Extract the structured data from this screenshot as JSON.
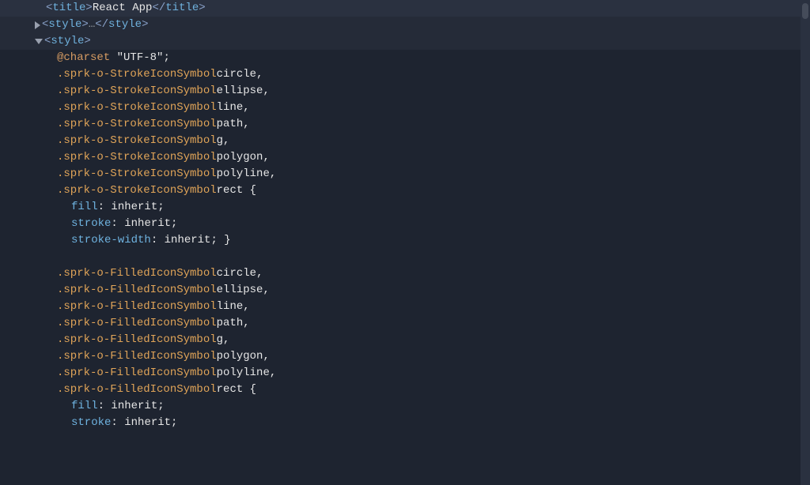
{
  "dom_tree": {
    "title_tag": {
      "open": "<title>",
      "text": "React App",
      "close": "</title>"
    },
    "collapsed_style": {
      "open": "<style>",
      "ellipsis": "…",
      "close": "</style>"
    },
    "expanded_style_open": "<style>"
  },
  "css": {
    "charset_rule": {
      "at": "@charset ",
      "value": "\"UTF-8\"",
      "semi": ";"
    },
    "stroke_selectors": [
      ".sprk-o-StrokeIconSymbol circle,",
      ".sprk-o-StrokeIconSymbol ellipse,",
      ".sprk-o-StrokeIconSymbol line,",
      ".sprk-o-StrokeIconSymbol path,",
      ".sprk-o-StrokeIconSymbol g,",
      ".sprk-o-StrokeIconSymbol polygon,",
      ".sprk-o-StrokeIconSymbol polyline,",
      ".sprk-o-StrokeIconSymbol rect {"
    ],
    "stroke_decls": [
      {
        "prop": "fill",
        "value": "inherit",
        "tail": ";"
      },
      {
        "prop": "stroke",
        "value": "inherit",
        "tail": ";"
      },
      {
        "prop": "stroke-width",
        "value": "inherit",
        "tail": "; }"
      }
    ],
    "filled_selectors": [
      ".sprk-o-FilledIconSymbol circle,",
      ".sprk-o-FilledIconSymbol ellipse,",
      ".sprk-o-FilledIconSymbol line,",
      ".sprk-o-FilledIconSymbol path,",
      ".sprk-o-FilledIconSymbol g,",
      ".sprk-o-FilledIconSymbol polygon,",
      ".sprk-o-FilledIconSymbol polyline,",
      ".sprk-o-FilledIconSymbol rect {"
    ],
    "filled_decls": [
      {
        "prop": "fill",
        "value": "inherit",
        "tail": ";"
      },
      {
        "prop": "stroke",
        "value": "inherit",
        "tail": ";"
      }
    ]
  }
}
